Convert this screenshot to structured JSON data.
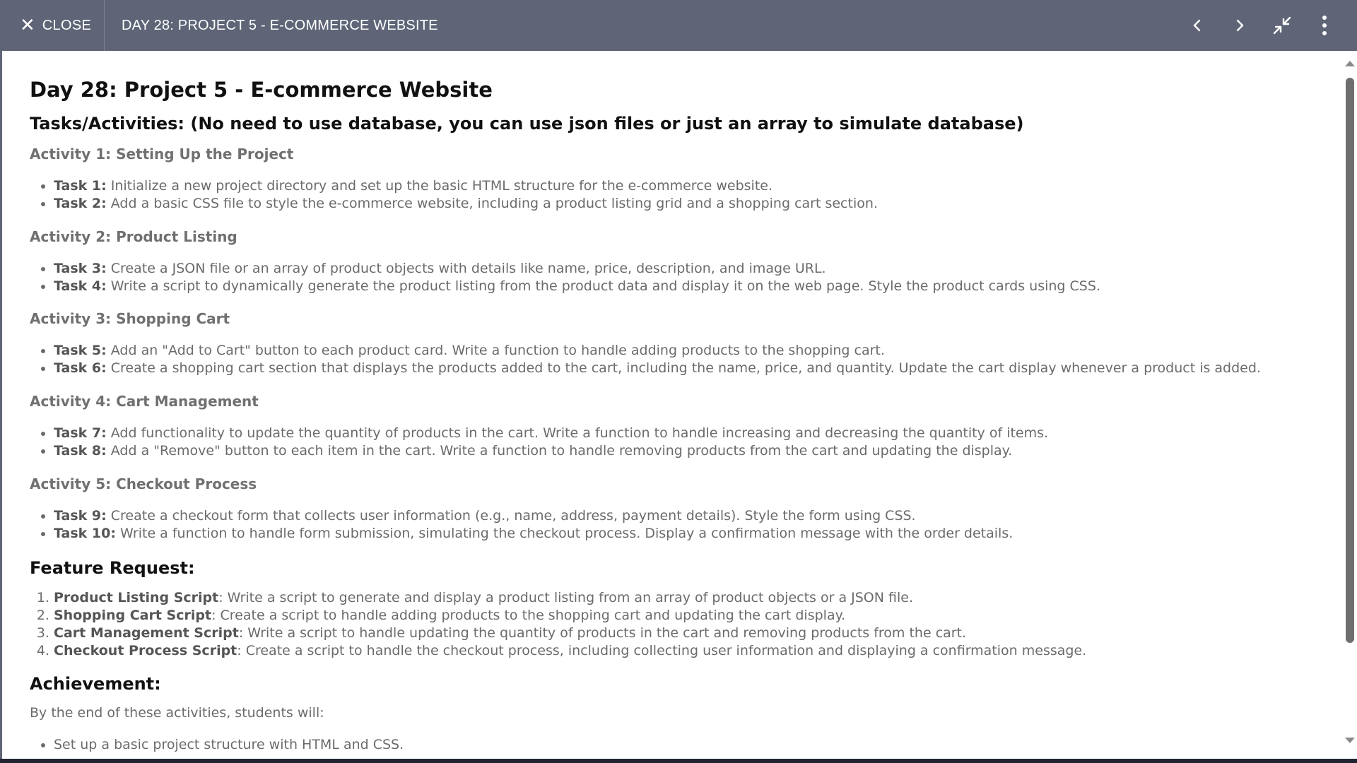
{
  "header": {
    "close_label": "CLOSE",
    "title": "DAY 28: PROJECT 5 - E-COMMERCE WEBSITE"
  },
  "doc": {
    "title": "Day 28: Project 5 - E-commerce Website",
    "tasks_heading": "Tasks/Activities: (No need to use database, you can use json files or just an array to simulate database)",
    "activities": [
      {
        "heading": "Activity 1: Setting Up the Project",
        "tasks": [
          {
            "label": "Task 1:",
            "text": " Initialize a new project directory and set up the basic HTML structure for the e-commerce website."
          },
          {
            "label": "Task 2:",
            "text": " Add a basic CSS file to style the e-commerce website, including a product listing grid and a shopping cart section."
          }
        ]
      },
      {
        "heading": "Activity 2: Product Listing",
        "tasks": [
          {
            "label": "Task 3:",
            "text": " Create a JSON file or an array of product objects with details like name, price, description, and image URL."
          },
          {
            "label": "Task 4:",
            "text": " Write a script to dynamically generate the product listing from the product data and display it on the web page. Style the product cards using CSS."
          }
        ]
      },
      {
        "heading": "Activity 3: Shopping Cart",
        "tasks": [
          {
            "label": "Task 5:",
            "text": " Add an \"Add to Cart\" button to each product card. Write a function to handle adding products to the shopping cart."
          },
          {
            "label": "Task 6:",
            "text": " Create a shopping cart section that displays the products added to the cart, including the name, price, and quantity. Update the cart display whenever a product is added."
          }
        ]
      },
      {
        "heading": "Activity 4: Cart Management",
        "tasks": [
          {
            "label": "Task 7:",
            "text": " Add functionality to update the quantity of products in the cart. Write a function to handle increasing and decreasing the quantity of items."
          },
          {
            "label": "Task 8:",
            "text": " Add a \"Remove\" button to each item in the cart. Write a function to handle removing products from the cart and updating the display."
          }
        ]
      },
      {
        "heading": "Activity 5: Checkout Process",
        "tasks": [
          {
            "label": "Task 9:",
            "text": " Create a checkout form that collects user information (e.g., name, address, payment details). Style the form using CSS."
          },
          {
            "label": "Task 10:",
            "text": " Write a function to handle form submission, simulating the checkout process. Display a confirmation message with the order details."
          }
        ]
      }
    ],
    "feature_heading": "Feature Request:",
    "features": [
      {
        "label": "Product Listing Script",
        "text": ": Write a script to generate and display a product listing from an array of product objects or a JSON file."
      },
      {
        "label": "Shopping Cart Script",
        "text": ": Create a script to handle adding products to the shopping cart and updating the cart display."
      },
      {
        "label": "Cart Management Script",
        "text": ": Write a script to handle updating the quantity of products in the cart and removing products from the cart."
      },
      {
        "label": "Checkout Process Script",
        "text": ": Create a script to handle the checkout process, including collecting user information and displaying a confirmation message."
      }
    ],
    "achievement_heading": "Achievement:",
    "achievement_intro": "By the end of these activities, students will:",
    "achievements": [
      "Set up a basic project structure with HTML and CSS."
    ]
  }
}
